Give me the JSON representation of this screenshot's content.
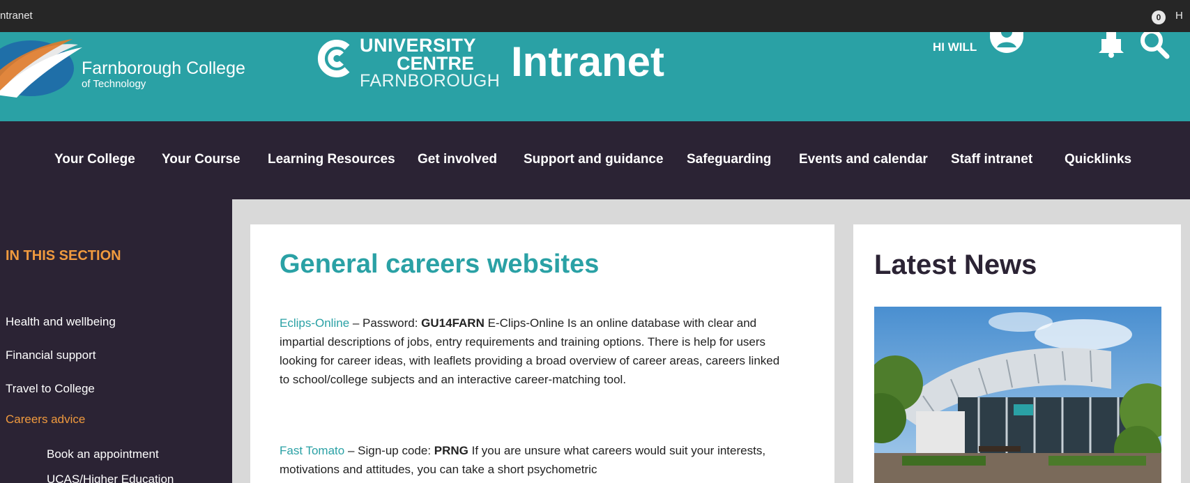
{
  "window": {
    "title": "ntranet",
    "badge_count": "0",
    "trailing": "H"
  },
  "header": {
    "college_name": "Farnborough College",
    "college_sub": "of Technology",
    "centre_line1": "UNIVERSITY",
    "centre_line2": "CENTRE",
    "centre_line3": "FARNBOROUGH",
    "site_title": "Intranet",
    "greeting": "HI WILL",
    "accent_color": "#2aa1a5"
  },
  "nav": {
    "items": [
      {
        "label": "Your College"
      },
      {
        "label": "Your Course"
      },
      {
        "label": "Learning Resources"
      },
      {
        "label": "Get involved"
      },
      {
        "label": "Support and guidance"
      },
      {
        "label": "Safeguarding"
      },
      {
        "label": "Events and calendar"
      },
      {
        "label": "Staff intranet"
      },
      {
        "label": "Quicklinks"
      }
    ]
  },
  "sidebar": {
    "section_title": "IN THIS SECTION",
    "items": [
      {
        "label": "Health and wellbeing"
      },
      {
        "label": "Financial support"
      },
      {
        "label": "Travel to College"
      },
      {
        "label": "Careers advice"
      }
    ],
    "subitems": [
      {
        "label": "Book an appointment"
      },
      {
        "label": "UCAS/Higher Education"
      }
    ],
    "highlight_color": "#f09a3e"
  },
  "main": {
    "heading": "General careers websites",
    "p1": {
      "link": "Eclips-Online",
      "pre": " – Password: ",
      "code": "GU14FARN",
      "text": "  E-Clips-Online Is an online database with clear and impartial descriptions of jobs, entry requirements and training options. There is help for users looking for career ideas, with leaflets providing a broad overview of career areas, careers linked to school/college subjects and an interactive career-matching tool."
    },
    "p2": {
      "link": "Fast Tomato",
      "pre": " –  Sign-up code: ",
      "code": "PRNG",
      "text": "  If you are unsure what careers would suit your interests, motivations and attitudes, you can take a short psychometric"
    }
  },
  "news": {
    "heading": "Latest News"
  }
}
